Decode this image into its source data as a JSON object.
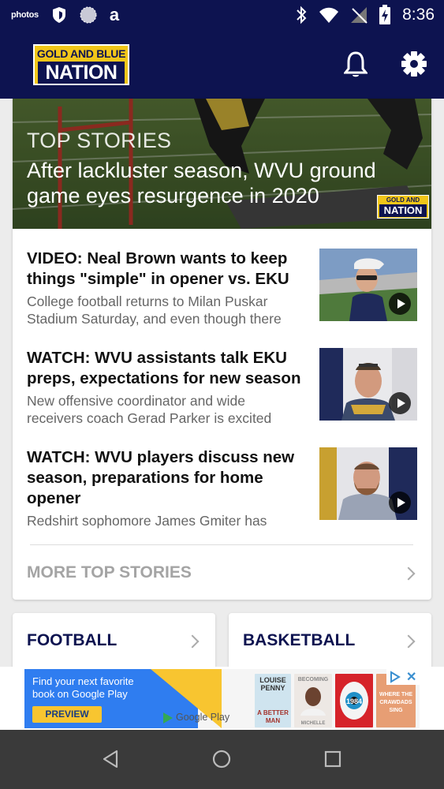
{
  "status_bar": {
    "time": "8:36",
    "notification_icons": [
      "photos-icon",
      "shield-icon",
      "sphere-icon",
      "amazon-icon"
    ],
    "photos_label": "photos",
    "amazon_label": "a"
  },
  "app_bar": {
    "logo_top": "GOLD AND BLUE",
    "logo_bottom": "NATION",
    "notifications_icon": "bell-icon",
    "settings_icon": "gear-icon"
  },
  "top_stories": {
    "section_label": "TOP STORIES",
    "hero_title": "After lackluster season, WVU ground game eyes resurgence in 2020",
    "hero_logo_top": "GOLD AND BLUE",
    "hero_logo_bottom": "NATION",
    "stories": [
      {
        "title": "VIDEO: Neal Brown wants to keep things \"simple\" in opener vs. EKU",
        "summary": "College football returns to Milan Puskar Stadium Saturday, and even though there"
      },
      {
        "title": "WATCH: WVU assistants talk EKU preps, expectations for new season",
        "summary": "New offensive coordinator and wide receivers coach Gerad Parker is excited"
      },
      {
        "title": "WATCH: WVU players discuss new season, preparations for home opener",
        "summary": "Redshirt sophomore James Gmiter has"
      }
    ],
    "more_label": "MORE TOP STORIES"
  },
  "categories": [
    {
      "label": "FOOTBALL"
    },
    {
      "label": "BASKETBALL"
    }
  ],
  "ad": {
    "headline": "Find your next favorite book on Google Play",
    "button": "PREVIEW",
    "brand": "Google Play",
    "books": [
      {
        "top": "LOUISE",
        "mid": "PENNY",
        "bot": "A BETTER MAN"
      },
      {
        "top": "BECOMING",
        "mid": "",
        "bot": "MICHELLE OBAMA"
      },
      {
        "top": "",
        "mid": "1984",
        "bot": ""
      },
      {
        "top": "WHERE THE",
        "mid": "CRAWDADS",
        "bot": "SING"
      }
    ],
    "close_label": "✕"
  },
  "nav_bar": {
    "buttons": [
      "back-icon",
      "home-icon",
      "recents-icon"
    ]
  },
  "colors": {
    "navy": "#0d1350",
    "gold": "#f1c619",
    "muted_text": "#a4a4a4"
  }
}
